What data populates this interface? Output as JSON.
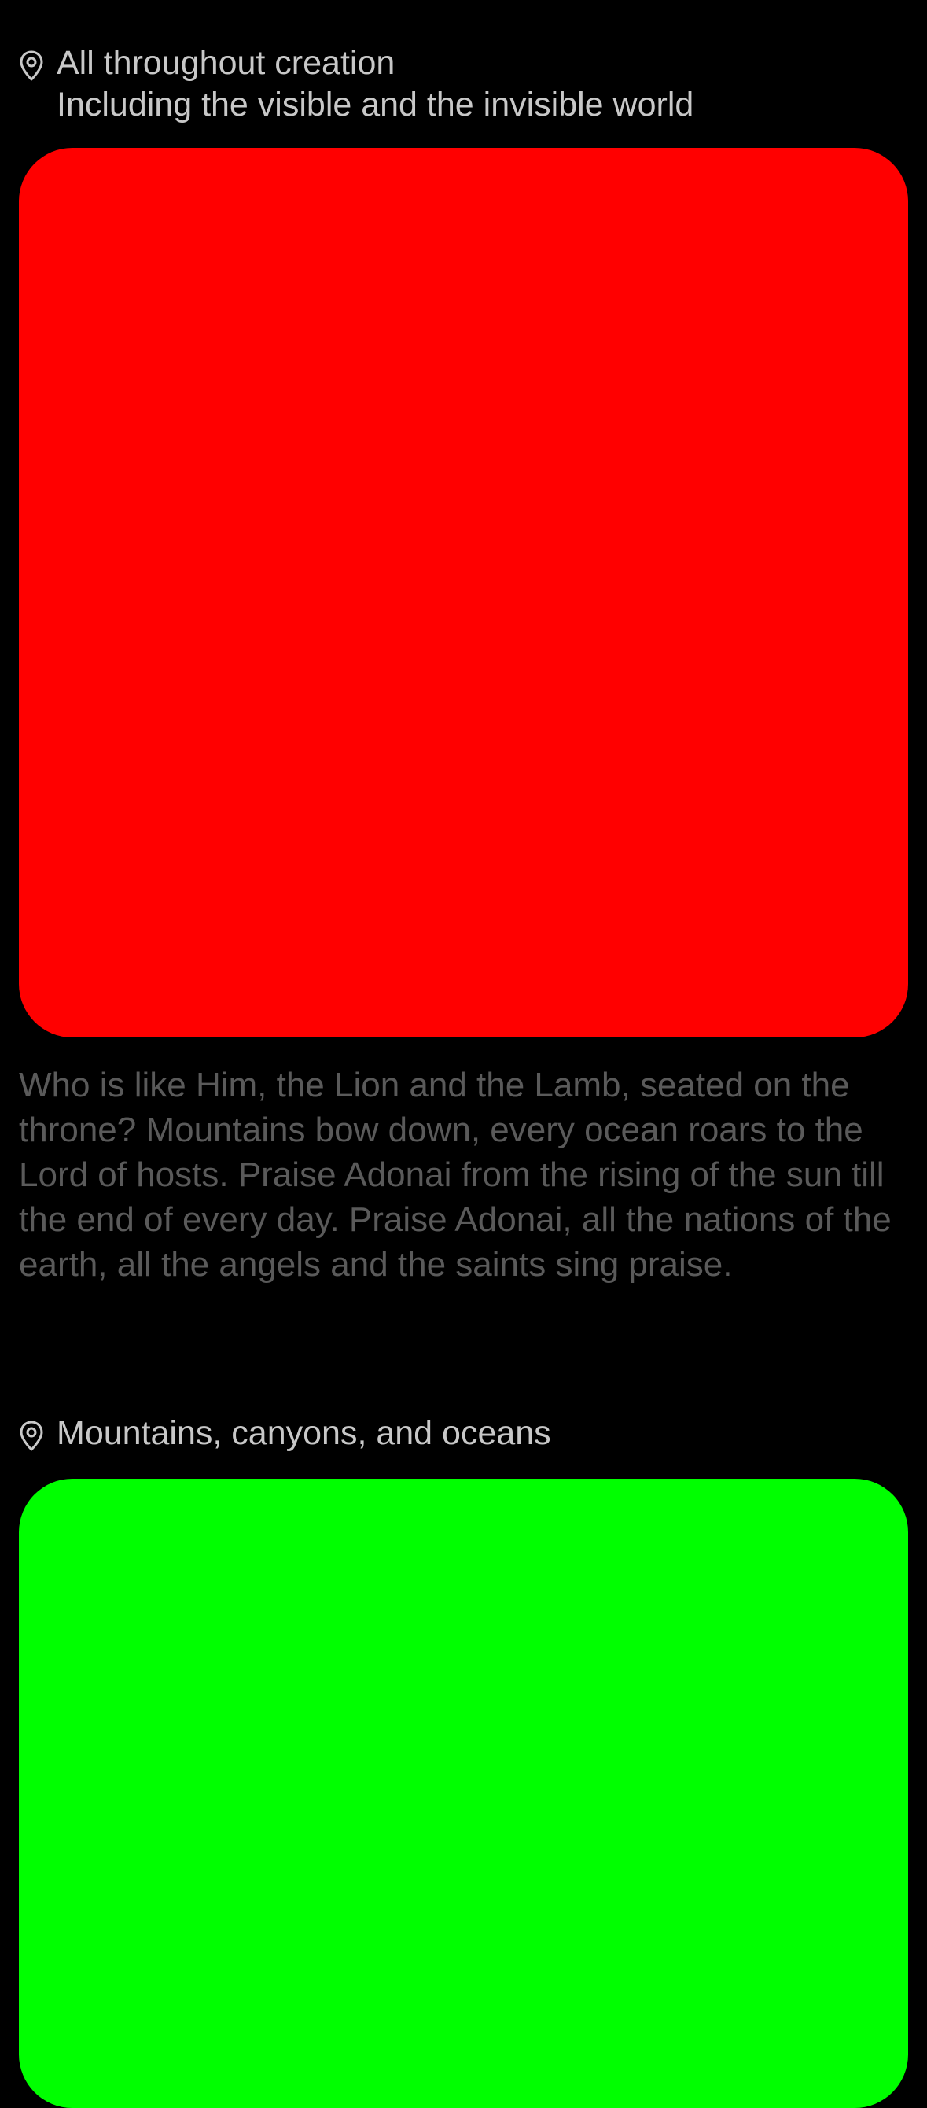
{
  "posts": [
    {
      "location_title": "All throughout creation",
      "location_subtitle": "Including the visible and the invisible world",
      "media_color": "#ff0000",
      "caption": "Who is like Him, the Lion and the Lamb, seated on the throne? Mountains bow down, every ocean roars to the Lord of hosts. Praise Adonai from the rising of the sun till the end of every day. Praise Adonai, all the nations of the earth, all the angels and the saints sing praise."
    },
    {
      "location_title": "Mountains, canyons, and oceans",
      "media_color": "#00ff00"
    }
  ],
  "icons": {
    "location": "map-pin-icon"
  },
  "colors": {
    "background": "#000000",
    "location_text": "#c8c8c8",
    "caption_text": "#5a5a5a"
  }
}
